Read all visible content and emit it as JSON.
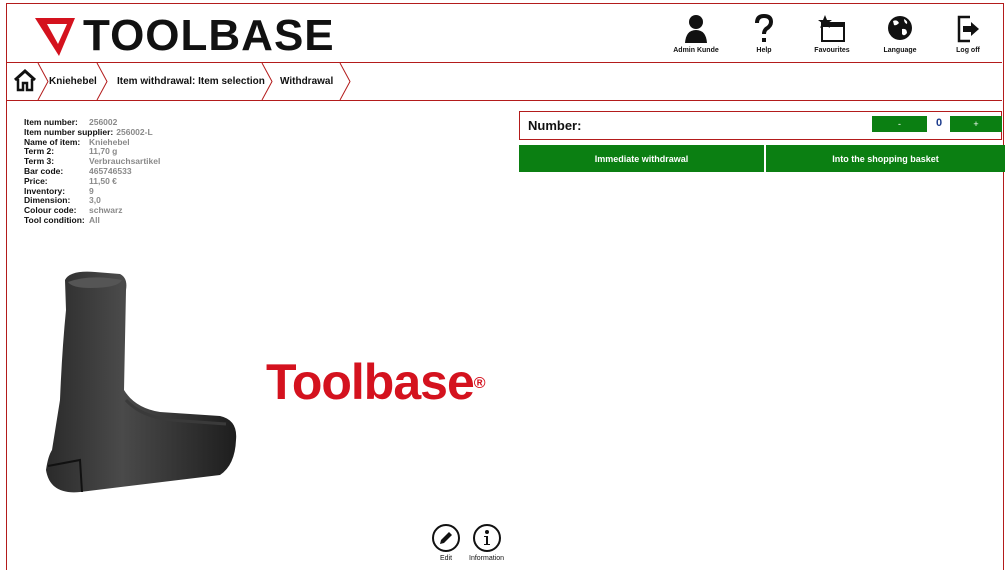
{
  "app": {
    "title": "TOOLBASE",
    "brand_watermark": "Toolbase"
  },
  "topnav": [
    {
      "label": "Admin Kunde",
      "icon": "user-icon"
    },
    {
      "label": "Help",
      "icon": "help-icon"
    },
    {
      "label": "Favourites",
      "icon": "favourites-icon"
    },
    {
      "label": "Language",
      "icon": "globe-icon"
    },
    {
      "label": "Log off",
      "icon": "logout-icon"
    }
  ],
  "breadcrumb": [
    "Kniehebel",
    "Item withdrawal: Item selection",
    "Withdrawal"
  ],
  "item_details": [
    {
      "label": "Item number:",
      "value": "256002"
    },
    {
      "label": "Item number supplier:",
      "value": "256002-L"
    },
    {
      "label": "Name of item:",
      "value": "Kniehebel"
    },
    {
      "label": "Term 2:",
      "value": "11,70 g"
    },
    {
      "label": "Term 3:",
      "value": "Verbrauchsartikel"
    },
    {
      "label": "Bar code:",
      "value": "465746533"
    },
    {
      "label": "Price:",
      "value": "11,50 €"
    },
    {
      "label": "Inventory:",
      "value": "9"
    },
    {
      "label": "Dimension:",
      "value": "3,0"
    },
    {
      "label": "Colour code:",
      "value": "schwarz"
    },
    {
      "label": "Tool condition:",
      "value": "All"
    }
  ],
  "number": {
    "label": "Number:",
    "value": "0",
    "minus": "-",
    "plus": "+"
  },
  "actions": {
    "withdraw": "Immediate withdrawal",
    "basket": "Into the shopping basket"
  },
  "bottom": {
    "edit": "Edit",
    "info": "Information"
  },
  "colors": {
    "accent_red": "#b31b1b",
    "brand_red": "#d4121e",
    "button_green": "#0b7f12"
  }
}
